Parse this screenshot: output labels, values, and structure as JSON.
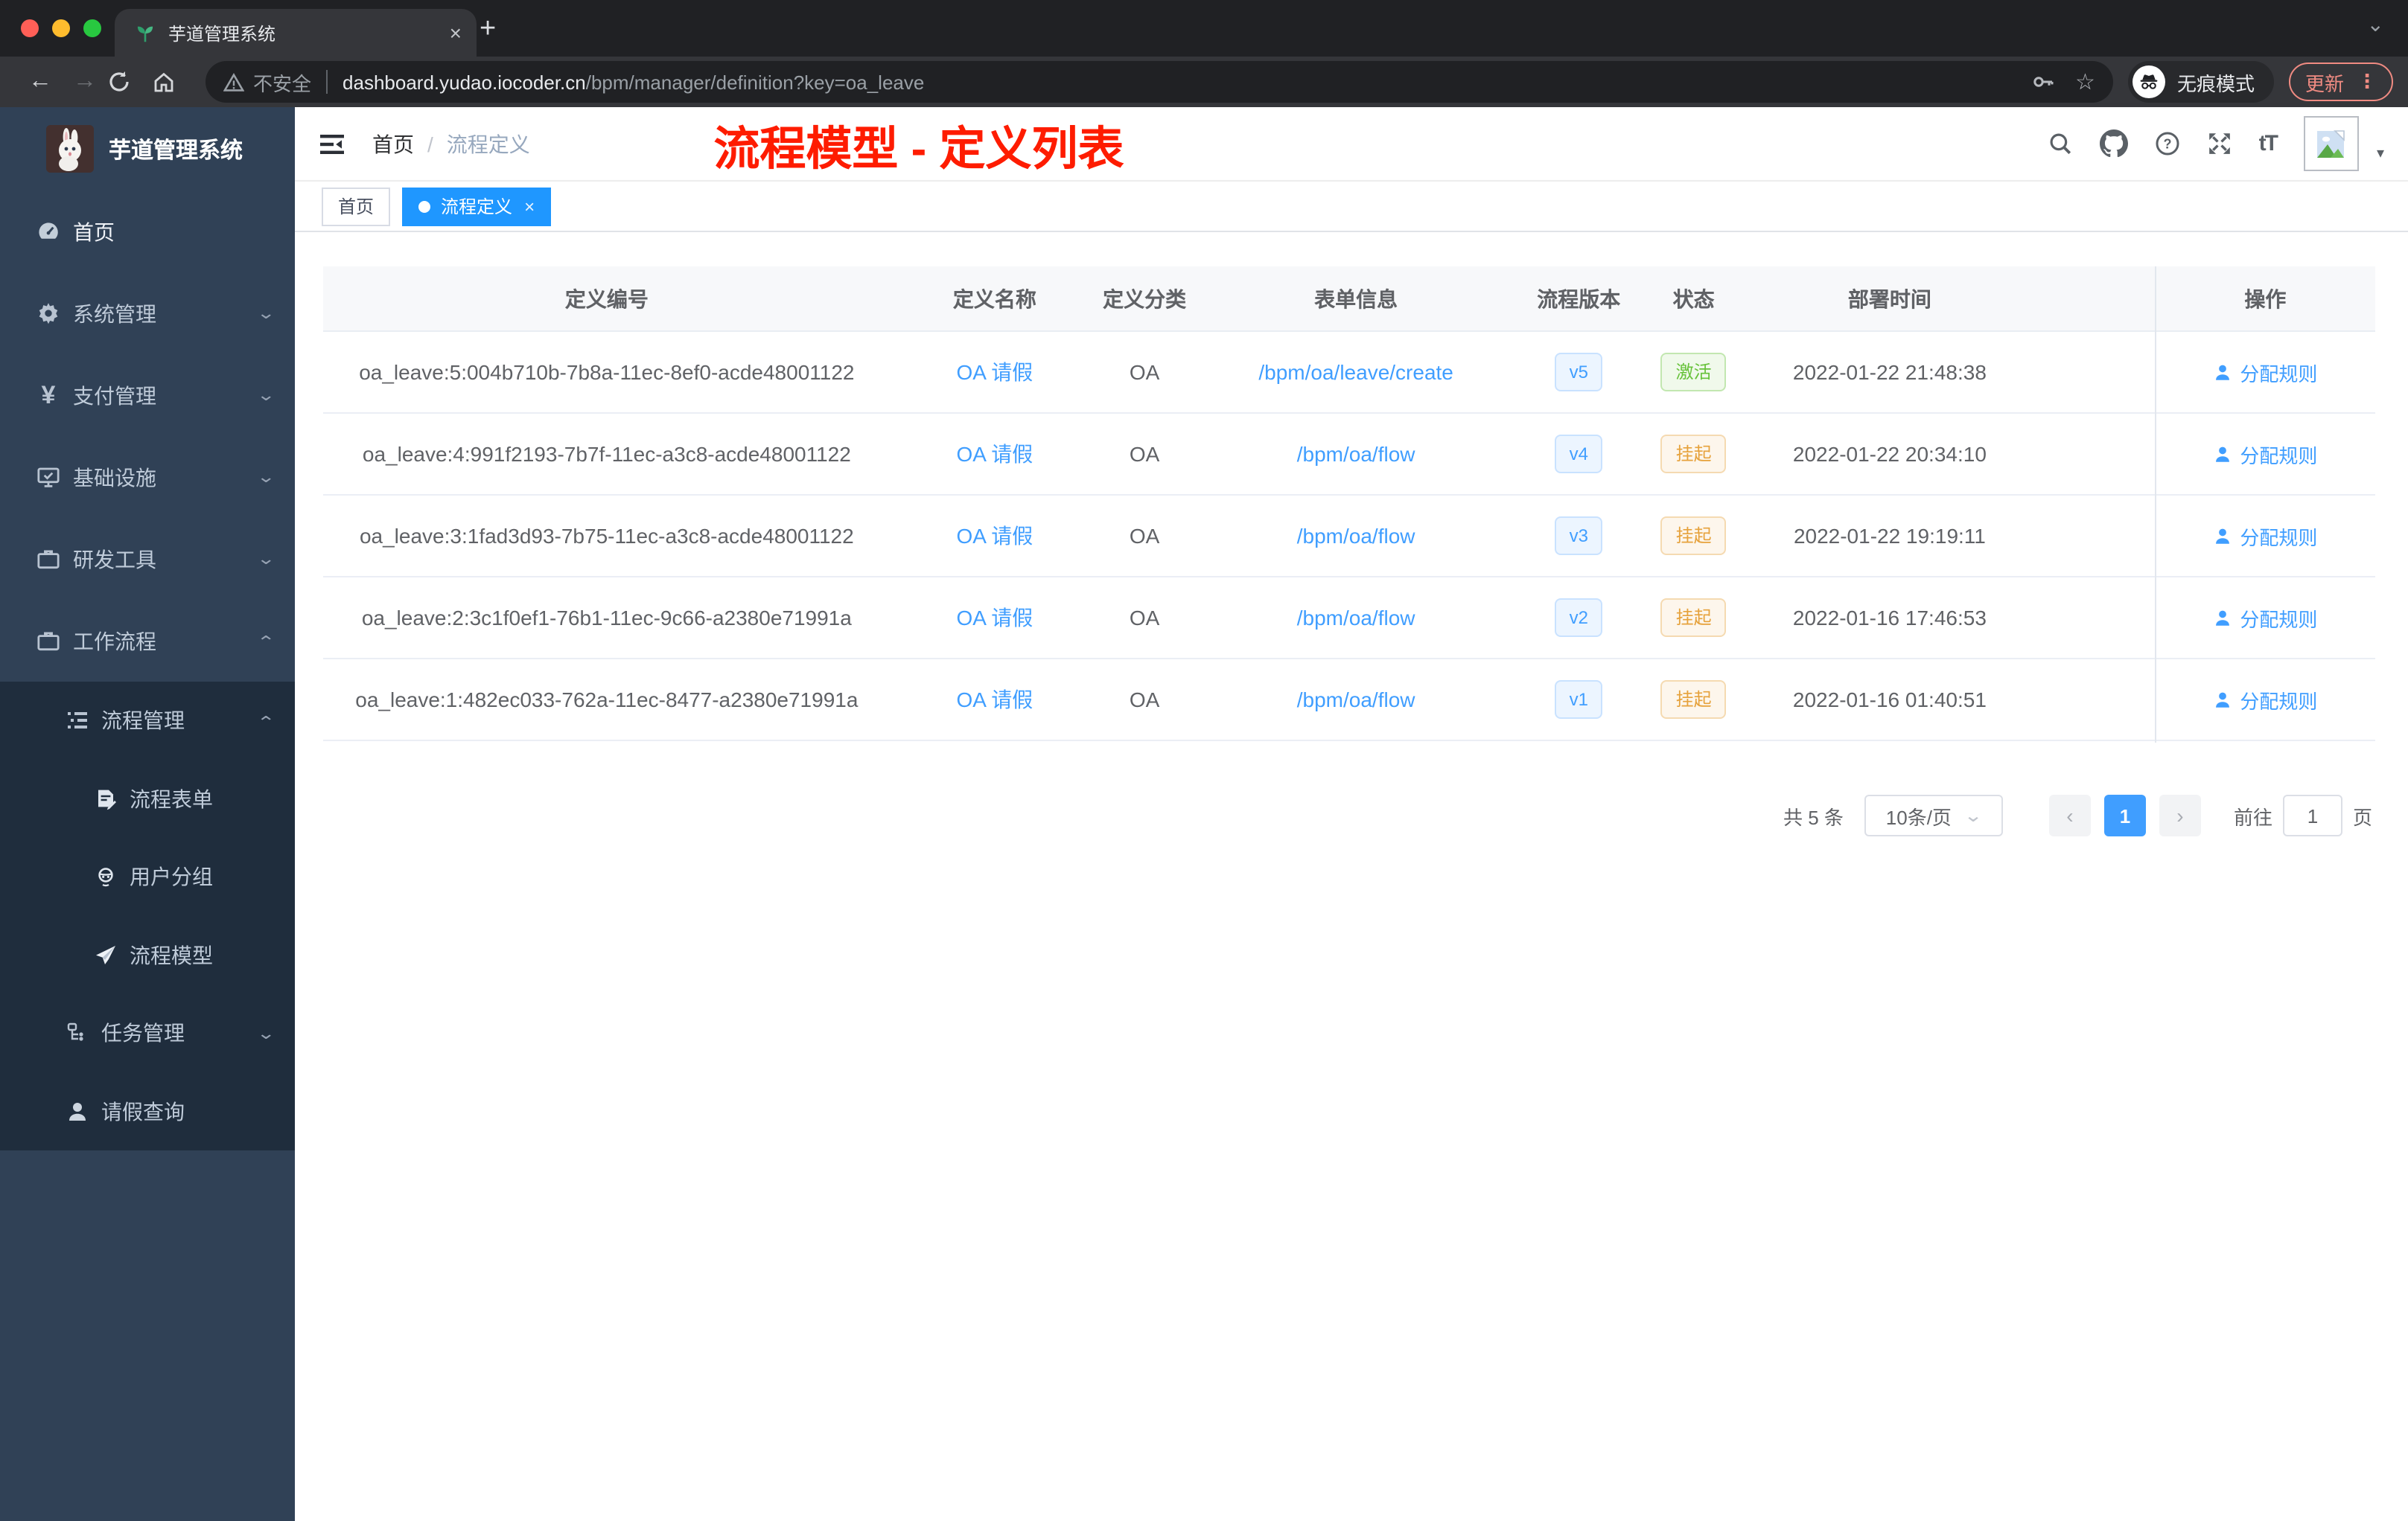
{
  "browser": {
    "tab_title": "芋道管理系统",
    "security_label": "不安全",
    "url_host": "dashboard.yudao.iocoder.cn",
    "url_path": "/bpm/manager/definition?key=oa_leave",
    "incognito_label": "无痕模式",
    "update_label": "更新"
  },
  "glyphs": {
    "close": "×",
    "plus": "+",
    "back": "←",
    "forward": "→",
    "star": "☆",
    "dots": "⋮",
    "caret_down": "⌄",
    "menu_caret": "▾",
    "font_size": "tT",
    "pager_prev": "‹",
    "pager_next": "›"
  },
  "sidebar": {
    "app_title": "芋道管理系统",
    "items": [
      {
        "label": "首页"
      },
      {
        "label": "系统管理"
      },
      {
        "label": "支付管理"
      },
      {
        "label": "基础设施"
      },
      {
        "label": "研发工具"
      },
      {
        "label": "工作流程"
      },
      {
        "label": "流程管理"
      },
      {
        "label": "流程表单"
      },
      {
        "label": "用户分组"
      },
      {
        "label": "流程模型"
      },
      {
        "label": "任务管理"
      },
      {
        "label": "请假查询"
      }
    ]
  },
  "header": {
    "breadcrumb": [
      "首页",
      "流程定义"
    ],
    "annotation": "流程模型 - 定义列表"
  },
  "tags": [
    {
      "label": "首页"
    },
    {
      "label": "流程定义"
    }
  ],
  "table": {
    "columns": [
      "定义编号",
      "定义名称",
      "定义分类",
      "表单信息",
      "流程版本",
      "状态",
      "部署时间",
      "操作"
    ],
    "rows": [
      {
        "id": "oa_leave:5:004b710b-7b8a-11ec-8ef0-acde48001122",
        "name": "OA 请假",
        "category": "OA",
        "form": "/bpm/oa/leave/create",
        "version": "v5",
        "status": "激活",
        "status_type": "success",
        "time": "2022-01-22 21:48:38",
        "action": "分配规则"
      },
      {
        "id": "oa_leave:4:991f2193-7b7f-11ec-a3c8-acde48001122",
        "name": "OA 请假",
        "category": "OA",
        "form": "/bpm/oa/flow",
        "version": "v4",
        "status": "挂起",
        "status_type": "warning",
        "time": "2022-01-22 20:34:10",
        "action": "分配规则"
      },
      {
        "id": "oa_leave:3:1fad3d93-7b75-11ec-a3c8-acde48001122",
        "name": "OA 请假",
        "category": "OA",
        "form": "/bpm/oa/flow",
        "version": "v3",
        "status": "挂起",
        "status_type": "warning",
        "time": "2022-01-22 19:19:11",
        "action": "分配规则"
      },
      {
        "id": "oa_leave:2:3c1f0ef1-76b1-11ec-9c66-a2380e71991a",
        "name": "OA 请假",
        "category": "OA",
        "form": "/bpm/oa/flow",
        "version": "v2",
        "status": "挂起",
        "status_type": "warning",
        "time": "2022-01-16 17:46:53",
        "action": "分配规则"
      },
      {
        "id": "oa_leave:1:482ec033-762a-11ec-8477-a2380e71991a",
        "name": "OA 请假",
        "category": "OA",
        "form": "/bpm/oa/flow",
        "version": "v1",
        "status": "挂起",
        "status_type": "warning",
        "time": "2022-01-16 01:40:51",
        "action": "分配规则"
      }
    ]
  },
  "pagination": {
    "total": "共 5 条",
    "page_size": "10条/页",
    "current_page": "1",
    "goto_label": "前往",
    "goto_value": "1",
    "unit_label": "页"
  },
  "colors": {
    "accent": "#409eff",
    "success": "#67c23a",
    "warning": "#e6a23c",
    "annotation_red": "#fe1c00",
    "sidebar_bg": "#304156",
    "submenu_bg": "#1f2d3d",
    "chrome_dark": "#202124",
    "toolbar": "#35363a",
    "update_salmon": "#f28b82",
    "active_tag": "#1f97ff"
  }
}
